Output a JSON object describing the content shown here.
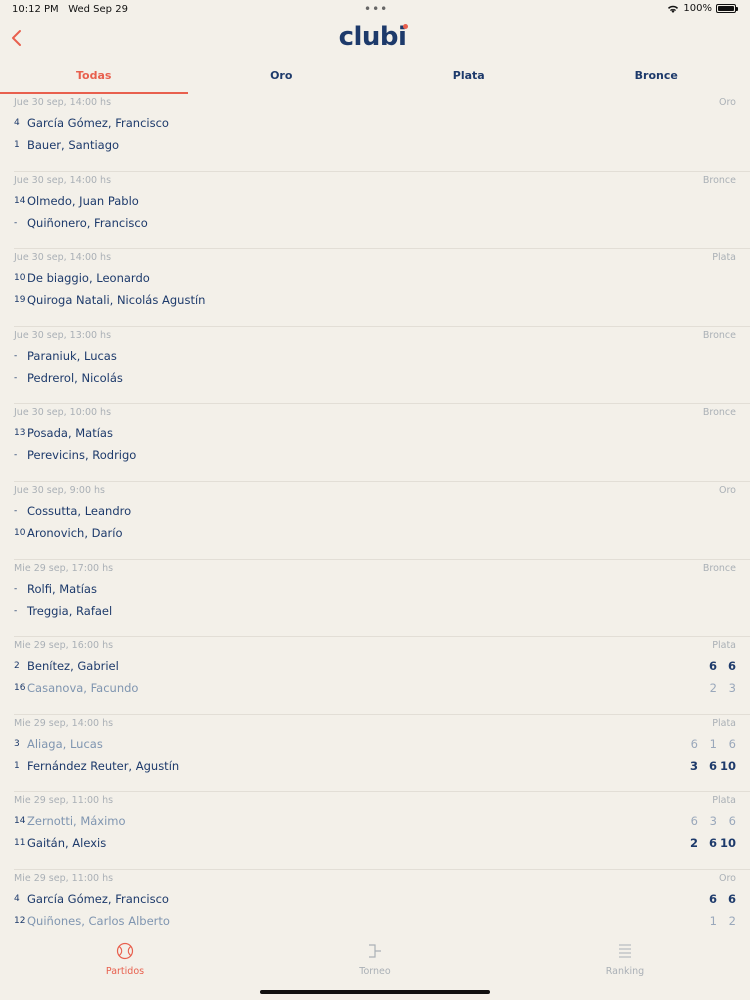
{
  "status": {
    "time": "10:12 PM",
    "date": "Wed Sep 29",
    "battery": "100%"
  },
  "header": {
    "logo": "clubi"
  },
  "tabs": [
    {
      "label": "Todas",
      "active": true
    },
    {
      "label": "Oro",
      "active": false
    },
    {
      "label": "Plata",
      "active": false
    },
    {
      "label": "Bronce",
      "active": false
    }
  ],
  "matches": [
    {
      "meta": "Jue 30 sep, 14:00 hs",
      "category": "Oro",
      "p1": {
        "seed": "4",
        "name": "García Gómez, Francisco",
        "scores": [],
        "loser": false
      },
      "p2": {
        "seed": "1",
        "name": "Bauer, Santiago",
        "scores": [],
        "loser": false
      }
    },
    {
      "meta": "Jue 30 sep, 14:00 hs",
      "category": "Bronce",
      "p1": {
        "seed": "14",
        "name": "Olmedo, Juan Pablo",
        "scores": [],
        "loser": false
      },
      "p2": {
        "seed": "-",
        "name": "Quiñonero, Francisco",
        "scores": [],
        "loser": false
      }
    },
    {
      "meta": "Jue 30 sep, 14:00 hs",
      "category": "Plata",
      "p1": {
        "seed": "10",
        "name": "De biaggio, Leonardo",
        "scores": [],
        "loser": false
      },
      "p2": {
        "seed": "19",
        "name": "Quiroga Natali, Nicolás Agustín",
        "scores": [],
        "loser": false
      }
    },
    {
      "meta": "Jue 30 sep, 13:00 hs",
      "category": "Bronce",
      "p1": {
        "seed": "-",
        "name": "Paraniuk, Lucas",
        "scores": [],
        "loser": false
      },
      "p2": {
        "seed": "-",
        "name": "Pedrerol, Nicolás",
        "scores": [],
        "loser": false
      }
    },
    {
      "meta": "Jue 30 sep, 10:00 hs",
      "category": "Bronce",
      "p1": {
        "seed": "13",
        "name": "Posada, Matías",
        "scores": [],
        "loser": false
      },
      "p2": {
        "seed": "-",
        "name": "Perevicins, Rodrigo",
        "scores": [],
        "loser": false
      }
    },
    {
      "meta": "Jue 30 sep, 9:00 hs",
      "category": "Oro",
      "p1": {
        "seed": "-",
        "name": "Cossutta, Leandro",
        "scores": [],
        "loser": false
      },
      "p2": {
        "seed": "10",
        "name": "Aronovich, Darío",
        "scores": [],
        "loser": false
      }
    },
    {
      "meta": "Mie 29 sep, 17:00 hs",
      "category": "Bronce",
      "p1": {
        "seed": "-",
        "name": "Rolfi, Matías",
        "scores": [],
        "loser": false
      },
      "p2": {
        "seed": "-",
        "name": "Treggia, Rafael",
        "scores": [],
        "loser": false
      }
    },
    {
      "meta": "Mie 29 sep, 16:00 hs",
      "category": "Plata",
      "p1": {
        "seed": "2",
        "name": "Benítez, Gabriel",
        "scores": [
          "6",
          "6"
        ],
        "loser": false
      },
      "p2": {
        "seed": "16",
        "name": "Casanova, Facundo",
        "scores": [
          "2",
          "3"
        ],
        "loser": true
      }
    },
    {
      "meta": "Mie 29 sep, 14:00 hs",
      "category": "Plata",
      "p1": {
        "seed": "3",
        "name": "Aliaga, Lucas",
        "scores": [
          "6",
          "1",
          "6"
        ],
        "loser": true
      },
      "p2": {
        "seed": "1",
        "name": "Fernández Reuter, Agustín",
        "scores": [
          "3",
          "6",
          "10"
        ],
        "loser": false
      }
    },
    {
      "meta": "Mie 29 sep, 11:00 hs",
      "category": "Plata",
      "p1": {
        "seed": "14",
        "name": "Zernotti, Máximo",
        "scores": [
          "6",
          "3",
          "6"
        ],
        "loser": true
      },
      "p2": {
        "seed": "11",
        "name": "Gaitán, Alexis",
        "scores": [
          "2",
          "6",
          "10"
        ],
        "loser": false
      }
    },
    {
      "meta": "Mie 29 sep, 11:00 hs",
      "category": "Oro",
      "p1": {
        "seed": "4",
        "name": "García Gómez, Francisco",
        "scores": [
          "6",
          "6"
        ],
        "loser": false
      },
      "p2": {
        "seed": "12",
        "name": "Quiñones, Carlos Alberto",
        "scores": [
          "1",
          "2"
        ],
        "loser": true
      }
    }
  ],
  "bottom_nav": [
    {
      "label": "Partidos",
      "icon": "tennis-ball-icon",
      "active": true
    },
    {
      "label": "Torneo",
      "icon": "bracket-icon",
      "active": false
    },
    {
      "label": "Ranking",
      "icon": "list-icon",
      "active": false
    }
  ],
  "colors": {
    "accent": "#e8604e",
    "primary": "#1d3a6b",
    "background": "#f3f0e9"
  }
}
